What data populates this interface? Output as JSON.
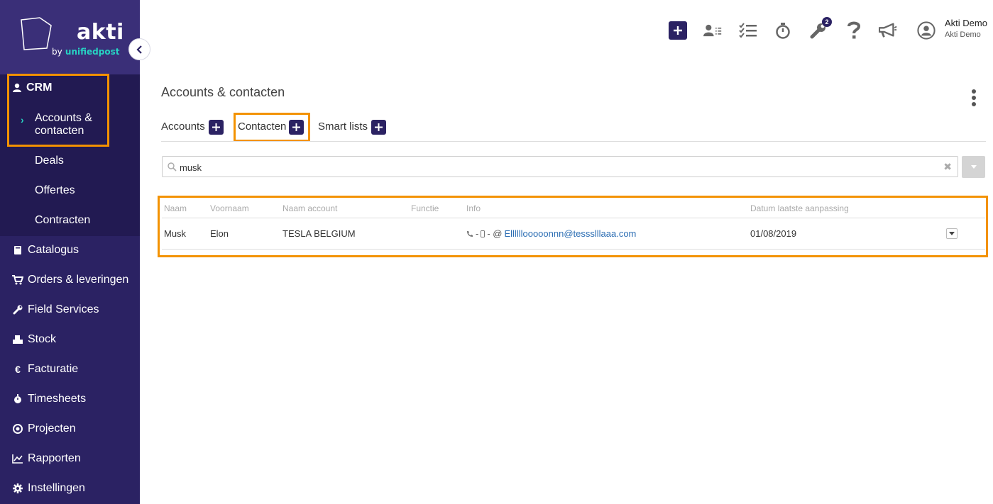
{
  "brand": {
    "name": "akti",
    "sub_by": "by",
    "sub_company": "unifiedpost"
  },
  "sidebar": {
    "crm_label": "CRM",
    "crm_items": [
      "Accounts &",
      "contacten",
      "Deals",
      "Offertes",
      "Contracten"
    ],
    "items": [
      {
        "label": "Catalogus",
        "icon": "book-icon"
      },
      {
        "label": "Orders & leveringen",
        "icon": "cart-icon"
      },
      {
        "label": "Field Services",
        "icon": "wrench-icon"
      },
      {
        "label": "Stock",
        "icon": "cubes-icon"
      },
      {
        "label": "Facturatie",
        "icon": "euro-icon"
      },
      {
        "label": "Timesheets",
        "icon": "stopwatch-icon"
      },
      {
        "label": "Projecten",
        "icon": "target-icon"
      },
      {
        "label": "Rapporten",
        "icon": "chart-icon"
      },
      {
        "label": "Instellingen",
        "icon": "gear-icon"
      }
    ]
  },
  "topbar": {
    "tools_badge": "2",
    "user_name": "Akti Demo",
    "user_company": "Akti Demo"
  },
  "page": {
    "title": "Accounts & contacten",
    "tabs": [
      {
        "label": "Accounts"
      },
      {
        "label": "Contacten"
      },
      {
        "label": "Smart lists"
      }
    ],
    "search": {
      "value": "musk"
    },
    "table": {
      "headers": [
        "Naam",
        "Voornaam",
        "Naam account",
        "Functie",
        "Info",
        "Datum laatste aanpassing"
      ],
      "rows": [
        {
          "naam": "Musk",
          "voornaam": "Elon",
          "account": "TESLA BELGIUM",
          "functie": "",
          "info_sep1": "-",
          "info_sep2": "- @",
          "email": "Ellllllooooonnn@tessslllaaa.com",
          "datum": "01/08/2019"
        }
      ]
    }
  },
  "colors": {
    "sidebar": "#2b2263",
    "accent": "#27d3c3",
    "highlight": "#f39200"
  }
}
